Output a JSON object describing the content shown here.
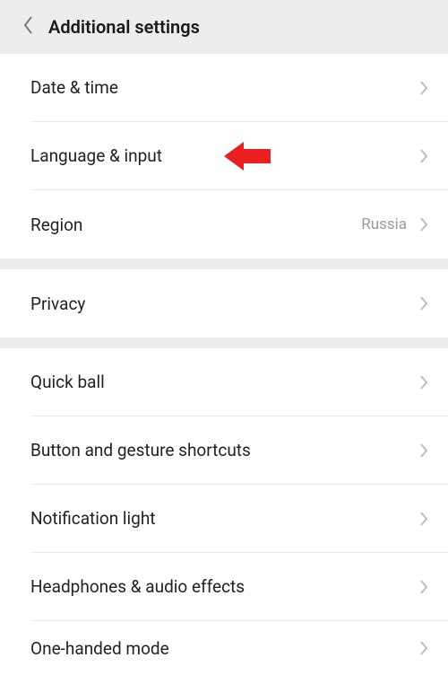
{
  "header": {
    "title": "Additional settings"
  },
  "groups": [
    {
      "rows": [
        {
          "label": "Date & time",
          "value": ""
        },
        {
          "label": "Language & input",
          "value": ""
        },
        {
          "label": "Region",
          "value": "Russia"
        }
      ]
    },
    {
      "rows": [
        {
          "label": "Privacy",
          "value": ""
        }
      ]
    },
    {
      "rows": [
        {
          "label": "Quick ball",
          "value": ""
        },
        {
          "label": "Button and gesture shortcuts",
          "value": ""
        },
        {
          "label": "Notification light",
          "value": ""
        },
        {
          "label": "Headphones & audio effects",
          "value": ""
        },
        {
          "label": "One-handed mode",
          "value": ""
        }
      ]
    }
  ],
  "annotation": {
    "color": "#ea1f1f"
  }
}
